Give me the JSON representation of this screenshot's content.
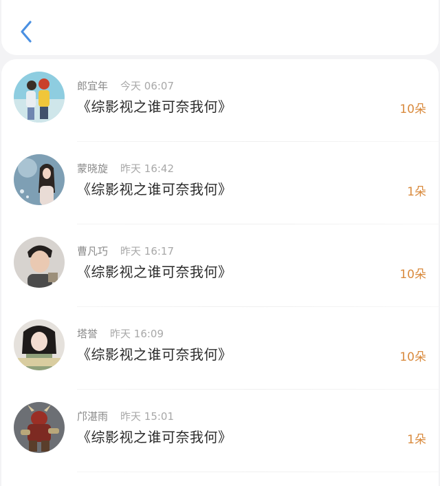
{
  "header": {
    "back_icon": "chevron-left-icon"
  },
  "items": [
    {
      "name": "郎宜年",
      "time": "今天 06:07",
      "title": "《综影视之谁可奈我何》",
      "count": "10朵"
    },
    {
      "name": "蒙晓旋",
      "time": "昨天 16:42",
      "title": "《综影视之谁可奈我何》",
      "count": "1朵"
    },
    {
      "name": "曹凡巧",
      "time": "昨天 16:17",
      "title": "《综影视之谁可奈我何》",
      "count": "10朵"
    },
    {
      "name": "塔誉",
      "time": "昨天 16:09",
      "title": "《综影视之谁可奈我何》",
      "count": "10朵"
    },
    {
      "name": "邝湛雨",
      "time": "昨天 15:01",
      "title": "《综影视之谁可奈我何》",
      "count": "1朵"
    }
  ],
  "colors": {
    "accent": "#4a90e2",
    "count": "#d98a3d"
  }
}
